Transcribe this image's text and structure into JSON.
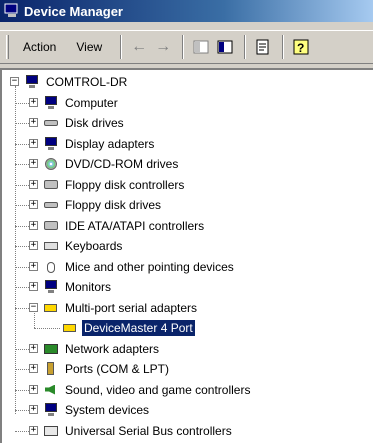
{
  "window": {
    "title": "Device Manager"
  },
  "menu": {
    "action_label": "Action",
    "view_label": "View"
  },
  "toolbar": {
    "buttons": [
      "back-icon",
      "forward-icon",
      "show-tree-icon",
      "properties-pane-icon",
      "properties-icon",
      "help-icon"
    ]
  },
  "colors": {
    "title_bar": "#0a246a",
    "selection": "#0a246a",
    "chrome": "#d4d0c8"
  },
  "tree": {
    "root": {
      "label": "COMTROL-DR",
      "icon": "computer-icon",
      "expanded": true
    },
    "items": [
      {
        "label": "Computer",
        "icon": "computer-icon",
        "expanded": false
      },
      {
        "label": "Disk drives",
        "icon": "disk-drive-icon",
        "expanded": false
      },
      {
        "label": "Display adapters",
        "icon": "monitor-icon",
        "expanded": false
      },
      {
        "label": "DVD/CD-ROM drives",
        "icon": "cdrom-icon",
        "expanded": false
      },
      {
        "label": "Floppy disk controllers",
        "icon": "controller-icon",
        "expanded": false
      },
      {
        "label": "Floppy disk drives",
        "icon": "floppy-drive-icon",
        "expanded": false
      },
      {
        "label": "IDE ATA/ATAPI controllers",
        "icon": "controller-icon",
        "expanded": false
      },
      {
        "label": "Keyboards",
        "icon": "keyboard-icon",
        "expanded": false
      },
      {
        "label": "Mice and other pointing devices",
        "icon": "mouse-icon",
        "expanded": false
      },
      {
        "label": "Monitors",
        "icon": "monitor-icon",
        "expanded": false
      },
      {
        "label": "Multi-port serial adapters",
        "icon": "serial-port-icon",
        "expanded": true,
        "children": [
          {
            "label": "DeviceMaster 4 Port",
            "icon": "serial-port-icon",
            "selected": true
          }
        ]
      },
      {
        "label": "Network adapters",
        "icon": "network-adapter-icon",
        "expanded": false
      },
      {
        "label": "Ports (COM & LPT)",
        "icon": "port-plug-icon",
        "expanded": false
      },
      {
        "label": "Sound, video and game controllers",
        "icon": "sound-icon",
        "expanded": false
      },
      {
        "label": "System devices",
        "icon": "computer-icon",
        "expanded": false
      },
      {
        "label": "Universal Serial Bus controllers",
        "icon": "usb-icon",
        "expanded": false
      }
    ]
  }
}
